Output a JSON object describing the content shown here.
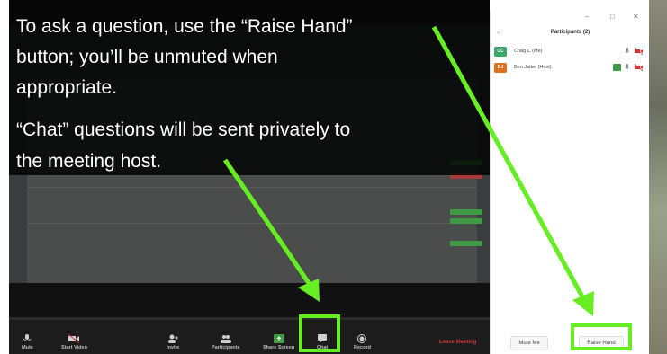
{
  "overlay": {
    "line1": "To ask a question, use the “Raise Hand”",
    "line2": "button; you’ll be unmuted when",
    "line3": "appropriate.",
    "line4": "“Chat” questions will be sent privately to",
    "line5": "the meeting host."
  },
  "toolbar": {
    "mute_label": "Mute",
    "start_video_label": "Start Video",
    "invite_label": "Invite",
    "participants_label": "Participants",
    "participants_count": "2",
    "share_screen_label": "Share Screen",
    "chat_label": "Chat",
    "record_label": "Record",
    "leave_label": "Leave Meeting"
  },
  "participants_panel": {
    "title": "Participants (2)",
    "people": [
      {
        "initials": "CC",
        "name": "Craig C (Me)",
        "avatar_color": "#3aa86b"
      },
      {
        "initials": "BJ",
        "name": "Ben Jatter (Host)",
        "avatar_color": "#e07020"
      }
    ],
    "mute_me_label": "Mute Me",
    "raise_hand_label": "Raise Hand"
  },
  "colors": {
    "highlight": "#66ee22",
    "leave": "#d93535",
    "overlay_text": "#ffffff"
  }
}
